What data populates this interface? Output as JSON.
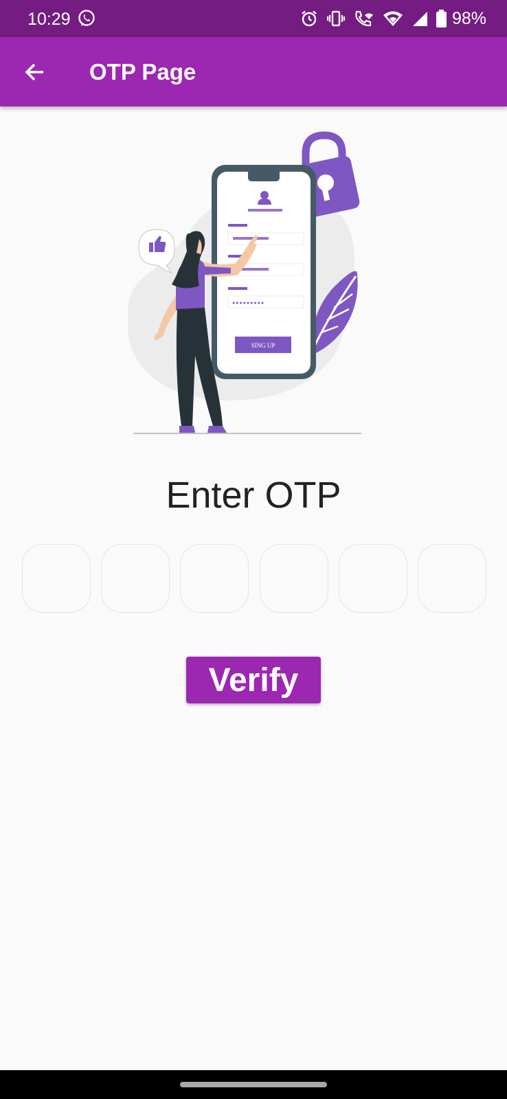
{
  "status_bar": {
    "time": "10:29",
    "battery_percent": "98%",
    "icons": [
      "whatsapp-icon",
      "alarm-icon",
      "vibrate-icon",
      "wifi-calling-icon",
      "wifi-icon",
      "cell-signal-icon",
      "battery-icon"
    ]
  },
  "app_bar": {
    "title": "OTP Page",
    "back_icon": "arrow-back-icon"
  },
  "illustration": {
    "form_button_label": "SING UP",
    "password_mask": "●●●●●●●●●",
    "icons": [
      "padlock-icon",
      "thumbs-up-icon",
      "user-icon",
      "leaf-icon"
    ]
  },
  "otp": {
    "heading": "Enter OTP",
    "digits": [
      "",
      "",
      "",
      "",
      "",
      ""
    ]
  },
  "verify_button": {
    "label": "Verify"
  },
  "colors": {
    "status_bar": "#741c82",
    "app_bar": "#9c27b0",
    "button": "#9c27b0",
    "illustration_accent": "#7e57c2",
    "background": "#fafafa"
  }
}
